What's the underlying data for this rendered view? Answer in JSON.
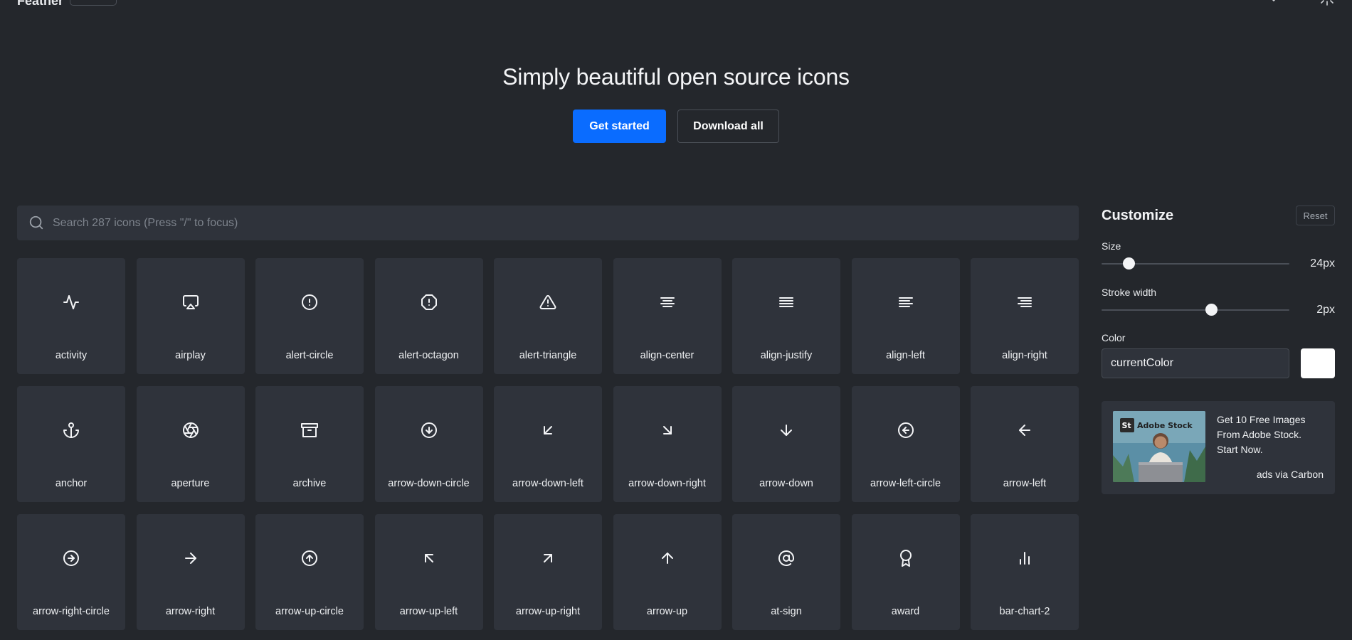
{
  "header": {
    "logo": "Feather"
  },
  "hero": {
    "title": "Simply beautiful open source icons",
    "primary_button": "Get started",
    "secondary_button": "Download all"
  },
  "search": {
    "placeholder": "Search 287 icons (Press \"/\" to focus)",
    "icon": "search-icon"
  },
  "icons": [
    {
      "label": "activity",
      "icon": "activity"
    },
    {
      "label": "airplay",
      "icon": "airplay"
    },
    {
      "label": "alert-circle",
      "icon": "alert-circle"
    },
    {
      "label": "alert-octagon",
      "icon": "alert-octagon"
    },
    {
      "label": "alert-triangle",
      "icon": "alert-triangle"
    },
    {
      "label": "align-center",
      "icon": "align-center"
    },
    {
      "label": "align-justify",
      "icon": "align-justify"
    },
    {
      "label": "align-left",
      "icon": "align-left"
    },
    {
      "label": "align-right",
      "icon": "align-right"
    },
    {
      "label": "anchor",
      "icon": "anchor"
    },
    {
      "label": "aperture",
      "icon": "aperture"
    },
    {
      "label": "archive",
      "icon": "archive"
    },
    {
      "label": "arrow-down-circle",
      "icon": "arrow-down-circle"
    },
    {
      "label": "arrow-down-left",
      "icon": "arrow-down-left"
    },
    {
      "label": "arrow-down-right",
      "icon": "arrow-down-right"
    },
    {
      "label": "arrow-down",
      "icon": "arrow-down"
    },
    {
      "label": "arrow-left-circle",
      "icon": "arrow-left-circle"
    },
    {
      "label": "arrow-left",
      "icon": "arrow-left"
    },
    {
      "label": "arrow-right-circle",
      "icon": "arrow-right-circle"
    },
    {
      "label": "arrow-right",
      "icon": "arrow-right"
    },
    {
      "label": "arrow-up-circle",
      "icon": "arrow-up-circle"
    },
    {
      "label": "arrow-up-left",
      "icon": "arrow-up-left"
    },
    {
      "label": "arrow-up-right",
      "icon": "arrow-up-right"
    },
    {
      "label": "arrow-up",
      "icon": "arrow-up"
    },
    {
      "label": "at-sign",
      "icon": "at-sign"
    },
    {
      "label": "award",
      "icon": "award"
    },
    {
      "label": "bar-chart-2",
      "icon": "bar-chart-2"
    }
  ],
  "customize": {
    "title": "Customize",
    "reset": "Reset",
    "size_label": "Size",
    "size_value": "24px",
    "size_fraction": 0.12,
    "stroke_label": "Stroke width",
    "stroke_value": "2px",
    "stroke_fraction": 0.59,
    "color_label": "Color",
    "color_value": "currentColor",
    "swatch_color": "#ffffff"
  },
  "ad": {
    "brand": "Adobe Stock",
    "brand_badge": "St",
    "text": "Get 10 Free Images From Adobe Stock. Start Now.",
    "credit": "ads via Carbon"
  },
  "colors": {
    "background": "#24272c",
    "tile": "#2f333b",
    "primary": "#0a6cff"
  }
}
